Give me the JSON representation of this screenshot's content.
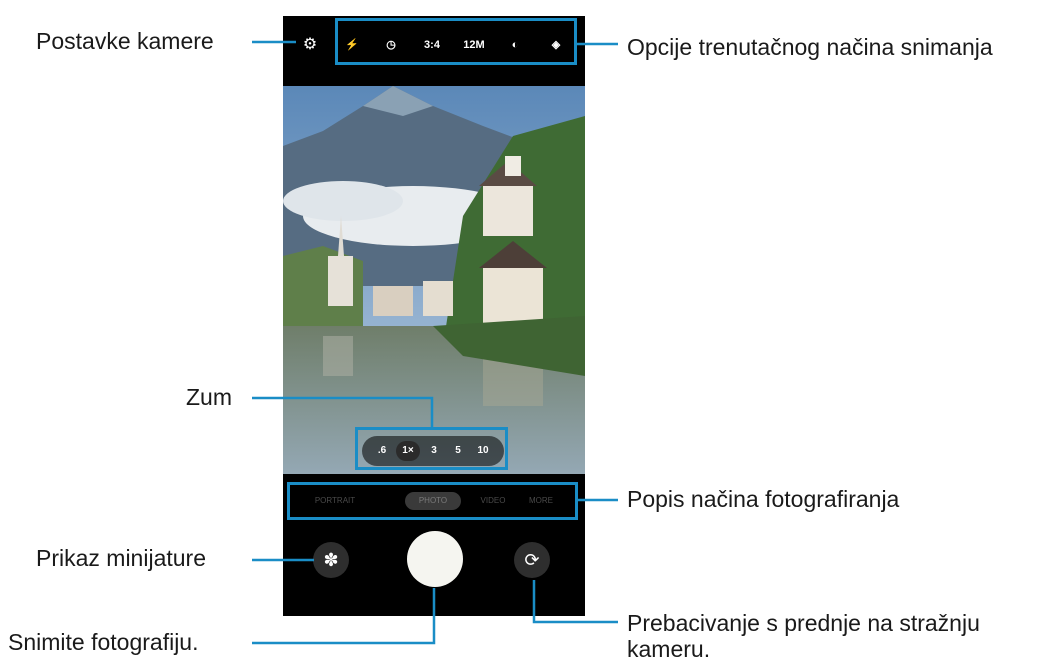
{
  "callouts": {
    "camera_settings": "Postavke kamere",
    "current_mode_options": "Opcije trenutačnog načina snimanja",
    "zoom": "Zum",
    "shooting_modes_list": "Popis načina fotografiranja",
    "thumbnail_preview": "Prikaz minijature",
    "take_photo": "Snimite fotografiju.",
    "switch_camera_line1": "Prebacivanje s prednje na stražnju",
    "switch_camera_line2": "kameru."
  },
  "topbar": {
    "settings_icon": "gear-icon",
    "options": [
      {
        "name": "flash-icon",
        "label": "⚡"
      },
      {
        "name": "timer-icon",
        "label": "◷"
      },
      {
        "name": "ratio",
        "label": "3:4"
      },
      {
        "name": "resolution",
        "label": "12M"
      },
      {
        "name": "motion-photo-icon",
        "label": "◐"
      },
      {
        "name": "filters-icon",
        "label": "◈"
      }
    ]
  },
  "zoom": {
    "levels": [
      ".6",
      "1×",
      "3",
      "5",
      "10"
    ],
    "selected": "1×"
  },
  "modes": {
    "items": [
      "PORTRAIT",
      "PHOTO",
      "VIDEO",
      "MORE"
    ],
    "selected": "PHOTO"
  },
  "bottom": {
    "thumbnail_icon": "✽",
    "switch_icon": "⟳"
  },
  "colors": {
    "callout_line": "#1a8dc6",
    "phone_bg": "#000000",
    "shutter": "#f5f5f0"
  }
}
